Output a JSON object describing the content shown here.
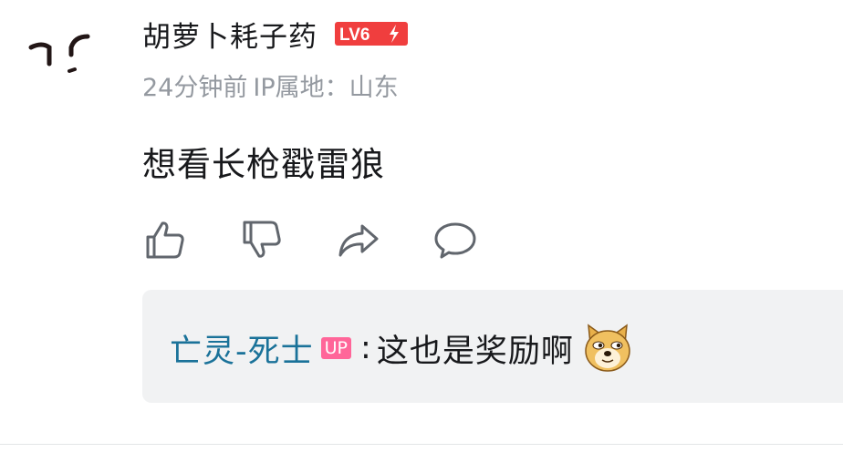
{
  "comment": {
    "username": "胡萝卜耗子药",
    "level_badge": "LV6",
    "time": "24分钟前",
    "ip_location": "IP属地：山东",
    "text": "想看长枪戳雷狼",
    "actions": [
      "like-icon",
      "dislike-icon",
      "share-icon",
      "reply-icon"
    ]
  },
  "reply": {
    "username": "亡灵-死士",
    "badge": "UP",
    "separator": ":",
    "text": "这也是奖励啊",
    "emoji": "doge-emoji"
  },
  "colors": {
    "level_badge": "#f03e3e",
    "reply_user": "#1a7299",
    "up_badge": "#ff6699",
    "meta": "#9499a0",
    "reply_bg": "#f1f2f3"
  }
}
